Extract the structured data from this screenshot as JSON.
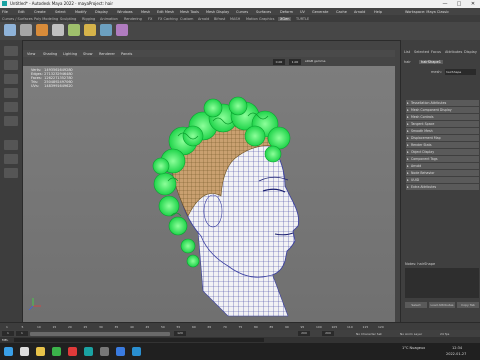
{
  "window": {
    "title": "Untitled* - Autodesk Maya 2022 · mayaProject: hair",
    "minimize": "—",
    "maximize": "□",
    "close": "✕"
  },
  "menubar": {
    "items": [
      "File",
      "Edit",
      "Create",
      "Select",
      "Modify",
      "Display",
      "Windows",
      "Mesh",
      "Edit Mesh",
      "Mesh Tools",
      "Mesh Display",
      "Curves",
      "Surfaces",
      "Deform",
      "UV",
      "Generate",
      "Cache",
      "Arnold",
      "Help"
    ],
    "workspace": "Workspace: Maya Classic"
  },
  "shelf": {
    "tabs": [
      "Curves / Surfaces",
      "Poly Modeling",
      "Sculpting",
      "Rigging",
      "Animation",
      "Rendering",
      "FX",
      "FX Caching",
      "Custom",
      "Arnold",
      "Bifrost",
      "MASH",
      "Motion Graphics",
      "XGen",
      "TURTLE"
    ],
    "active_tab": "XGen",
    "icons": [
      {
        "name": "select-icon",
        "color": "#8fb3d9"
      },
      {
        "name": "lasso-icon",
        "color": "#a6a6a6"
      },
      {
        "name": "paint-icon",
        "color": "#d98c3a"
      },
      {
        "name": "sphere-icon",
        "color": "#c0c0c0"
      },
      {
        "name": "cube-icon",
        "color": "#9fc06c"
      },
      {
        "name": "cylinder-icon",
        "color": "#d6b34a"
      },
      {
        "name": "plane-icon",
        "color": "#6ca0c0"
      },
      {
        "name": "torus-icon",
        "color": "#b07cc0"
      }
    ]
  },
  "viewport": {
    "menu": [
      "View",
      "Shading",
      "Lighting",
      "Show",
      "Renderer",
      "Panels"
    ],
    "hud": {
      "rows": [
        {
          "label": "Verts:",
          "a": "149356",
          "b": "164928",
          "c": "0"
        },
        {
          "label": "Edges:",
          "a": "271323",
          "b": "294648",
          "c": "0"
        },
        {
          "label": "Faces:",
          "a": "126227",
          "b": "135278",
          "c": "0"
        },
        {
          "label": "Tris:",
          "a": "250489",
          "b": "249706",
          "c": "0"
        },
        {
          "label": "UVs:",
          "a": "148399",
          "b": "164962",
          "c": "0"
        }
      ]
    },
    "fields": {
      "a": "0.00",
      "b": "1.00",
      "colorspace": "sRGB gamma"
    }
  },
  "rightpanel": {
    "tabs": [
      "List",
      "Selected",
      "Focus",
      "Attributes",
      "Display",
      "Show",
      "Help"
    ],
    "node_tabs": [
      "hair",
      "hairShape1"
    ],
    "label": "mesh:",
    "node_field": "hairShape",
    "sections": [
      "Tessellation Attributes",
      "Mesh Component Display",
      "Mesh Controls",
      "Tangent Space",
      "Smooth Mesh",
      "Displacement Map",
      "Render Stats",
      "Object Display",
      "Component Tags",
      "Arnold",
      "Node Behavior",
      "UUID",
      "Extra Attributes"
    ],
    "notes_label": "Notes: hairShape",
    "buttons": [
      "Select",
      "Load Attributes",
      "Copy Tab"
    ]
  },
  "timeline": {
    "ticks": [
      "1",
      "5",
      "10",
      "15",
      "20",
      "25",
      "30",
      "35",
      "40",
      "45",
      "50",
      "55",
      "60",
      "65",
      "70",
      "75",
      "80",
      "85",
      "90",
      "95",
      "100",
      "105",
      "110",
      "115",
      "120"
    ]
  },
  "range": {
    "start": "1",
    "start2": "1",
    "end": "120",
    "end2": "200",
    "end3": "200",
    "char_set": "No Character Set",
    "anim_layer": "No Anim Layer",
    "fps": "24 fps"
  },
  "cmdline": {
    "label": "MEL"
  },
  "taskbar": {
    "icons": [
      {
        "name": "windows-start-icon",
        "color": "#3aa0e8"
      },
      {
        "name": "search-icon",
        "color": "#ddd"
      },
      {
        "name": "explorer-icon",
        "color": "#e8c34a"
      },
      {
        "name": "chrome-icon",
        "color": "#3bb34a"
      },
      {
        "name": "opera-icon",
        "color": "#e03a3a"
      },
      {
        "name": "maya-icon",
        "color": "#1aa3a3"
      },
      {
        "name": "obs-icon",
        "color": "#777"
      },
      {
        "name": "photos-icon",
        "color": "#3a7be0"
      },
      {
        "name": "edge-icon",
        "color": "#2a8fd0"
      }
    ],
    "weather": "1°C  Nuageux",
    "time": "12:34",
    "date": "2022-01-27"
  }
}
